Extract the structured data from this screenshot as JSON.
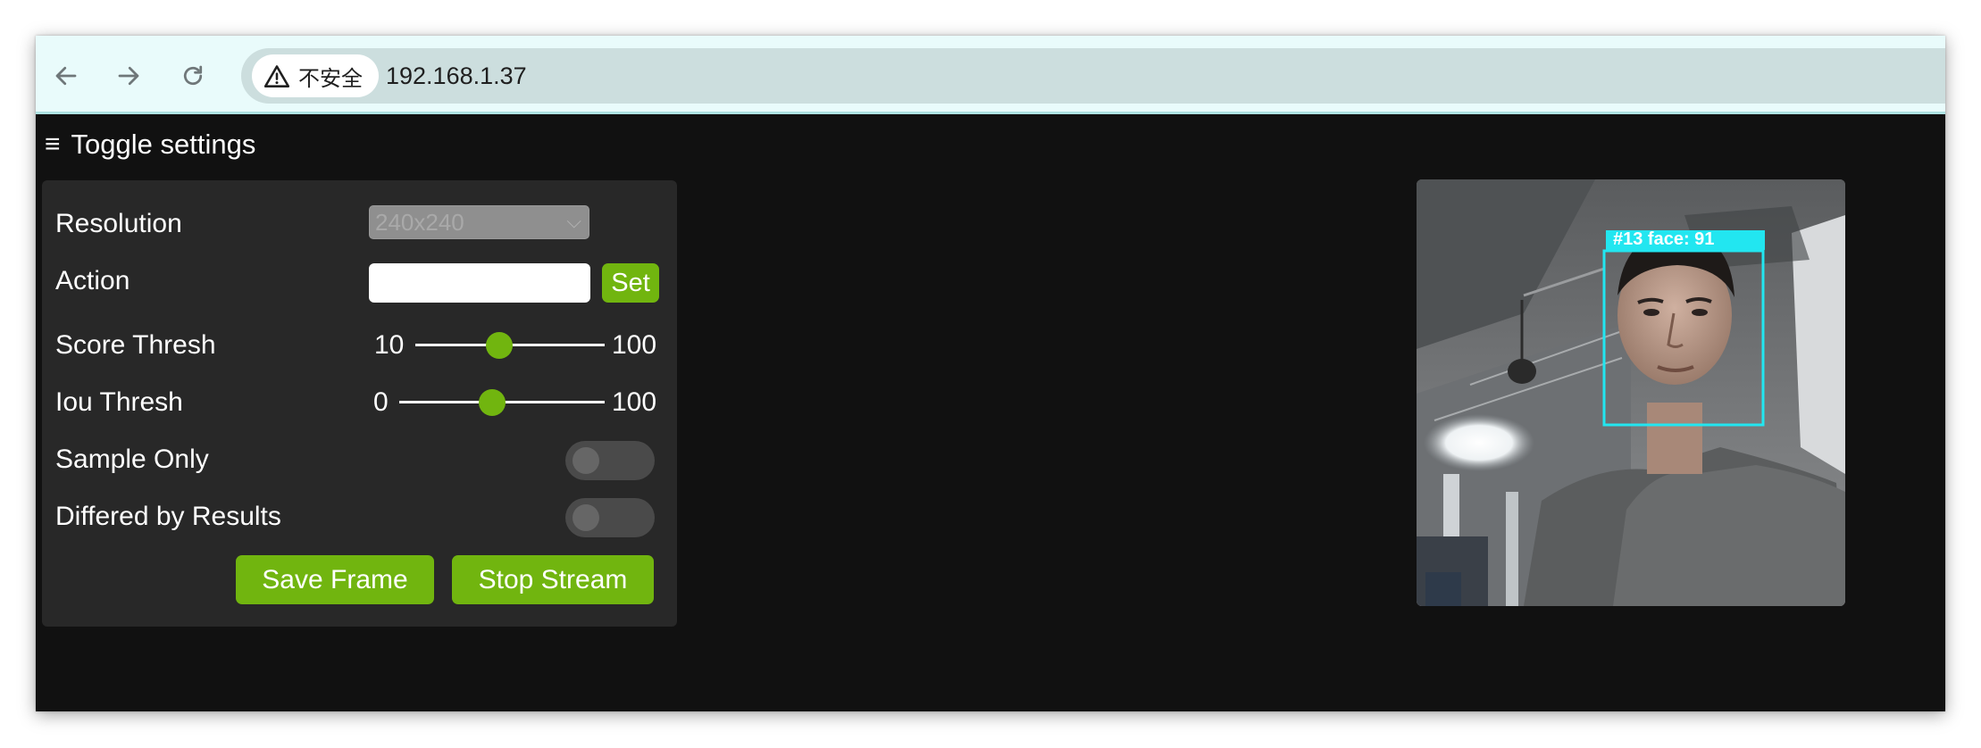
{
  "browser": {
    "security_label": "不安全",
    "url": "192.168.1.37"
  },
  "app": {
    "toggle_label": "Toggle settings"
  },
  "settings": {
    "resolution": {
      "label": "Resolution",
      "value": "240x240"
    },
    "action": {
      "label": "Action",
      "value": "",
      "button": "Set"
    },
    "score_thresh": {
      "label": "Score Thresh",
      "min": "10",
      "max": "100",
      "value": 50
    },
    "iou_thresh": {
      "label": "Iou Thresh",
      "min": "0",
      "max": "100",
      "value": 45
    },
    "sample_only": {
      "label": "Sample Only",
      "on": false
    },
    "differed_by_results": {
      "label": "Differed by Results",
      "on": false
    },
    "save_frame_label": "Save Frame",
    "stop_stream_label": "Stop Stream"
  },
  "video": {
    "detection_label": "#13 face: 91"
  },
  "colors": {
    "accent": "#71b50f",
    "panel": "#282828",
    "page_bg": "#111111",
    "detection_box": "#22e6f0"
  }
}
